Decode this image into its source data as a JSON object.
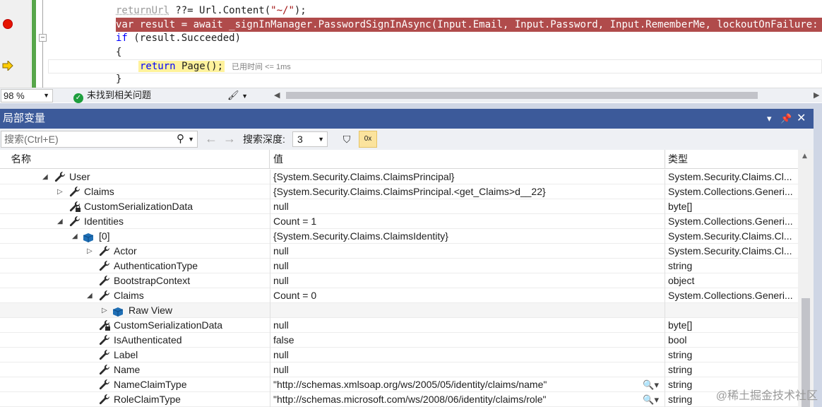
{
  "editor": {
    "lines": {
      "l1_faded": "returnUrl",
      "l1_rest": " ??= Url.Content(",
      "l1_str": "\"~/\"",
      "l1_end": ");",
      "l2": "var result = await _signInManager.PasswordSignInAsync(Input.Email, Input.Password, Input.RememberMe, lockoutOnFailure: false);",
      "l3_kw": "if",
      "l3_rest": " (result.Succeeded)",
      "l4": "{",
      "l5_kw": "return",
      "l5_rest": " Page();",
      "l5_elapsed": "已用时间 <= 1ms",
      "l6": "}"
    }
  },
  "statusbar": {
    "zoom": "98 %",
    "issues": "未找到相关问题"
  },
  "locals": {
    "title": "局部变量",
    "search_placeholder": "搜索(Ctrl+E)",
    "depth_label": "搜索深度:",
    "depth_value": "3",
    "columns": {
      "name": "名称",
      "value": "值",
      "type": "类型"
    },
    "rows": [
      {
        "name": "User",
        "value": "{System.Security.Claims.ClaimsPrincipal}",
        "type": "System.Security.Claims.Cl...",
        "indent": 0,
        "expander": "open",
        "icon": "wrench"
      },
      {
        "name": "Claims",
        "value": "{System.Security.Claims.ClaimsPrincipal.<get_Claims>d__22}",
        "type": "System.Collections.Generi...",
        "indent": 1,
        "expander": "closed",
        "icon": "wrench"
      },
      {
        "name": "CustomSerializationData",
        "value": "null",
        "type": "byte[]",
        "indent": 1,
        "expander": "none",
        "icon": "wrench-lock"
      },
      {
        "name": "Identities",
        "value": "Count = 1",
        "type": "System.Collections.Generi...",
        "indent": 1,
        "expander": "open",
        "icon": "wrench"
      },
      {
        "name": "[0]",
        "value": "{System.Security.Claims.ClaimsIdentity}",
        "type": "System.Security.Claims.Cl...",
        "indent": 2,
        "expander": "open",
        "icon": "cube"
      },
      {
        "name": "Actor",
        "value": "null",
        "type": "System.Security.Claims.Cl...",
        "indent": 3,
        "expander": "closed",
        "icon": "wrench"
      },
      {
        "name": "AuthenticationType",
        "value": "null",
        "type": "string",
        "indent": 3,
        "expander": "none",
        "icon": "wrench"
      },
      {
        "name": "BootstrapContext",
        "value": "null",
        "type": "object",
        "indent": 3,
        "expander": "none",
        "icon": "wrench"
      },
      {
        "name": "Claims",
        "value": "Count = 0",
        "type": "System.Collections.Generi...",
        "indent": 3,
        "expander": "open",
        "icon": "wrench"
      },
      {
        "name": "Raw View",
        "value": "",
        "type": "",
        "indent": 4,
        "expander": "closed",
        "icon": "cube"
      },
      {
        "name": "CustomSerializationData",
        "value": "null",
        "type": "byte[]",
        "indent": 3,
        "expander": "none",
        "icon": "wrench-lock"
      },
      {
        "name": "IsAuthenticated",
        "value": "false",
        "type": "bool",
        "indent": 3,
        "expander": "none",
        "icon": "wrench"
      },
      {
        "name": "Label",
        "value": "null",
        "type": "string",
        "indent": 3,
        "expander": "none",
        "icon": "wrench"
      },
      {
        "name": "Name",
        "value": "null",
        "type": "string",
        "indent": 3,
        "expander": "none",
        "icon": "wrench"
      },
      {
        "name": "NameClaimType",
        "value": "\"http://schemas.xmlsoap.org/ws/2005/05/identity/claims/name\"",
        "type": "string",
        "indent": 3,
        "expander": "none",
        "icon": "wrench",
        "visualizer": true
      },
      {
        "name": "RoleClaimType",
        "value": "\"http://schemas.microsoft.com/ws/2008/06/identity/claims/role\"",
        "type": "string",
        "indent": 3,
        "expander": "none",
        "icon": "wrench",
        "visualizer": true
      }
    ]
  },
  "watermark": "@稀土掘金技术社区",
  "colors": {
    "breakpoint_line": "#b04b4b",
    "panel_title": "#3c5a9a",
    "change_bar": "#57a64a",
    "breakpoint": "#e51400"
  }
}
